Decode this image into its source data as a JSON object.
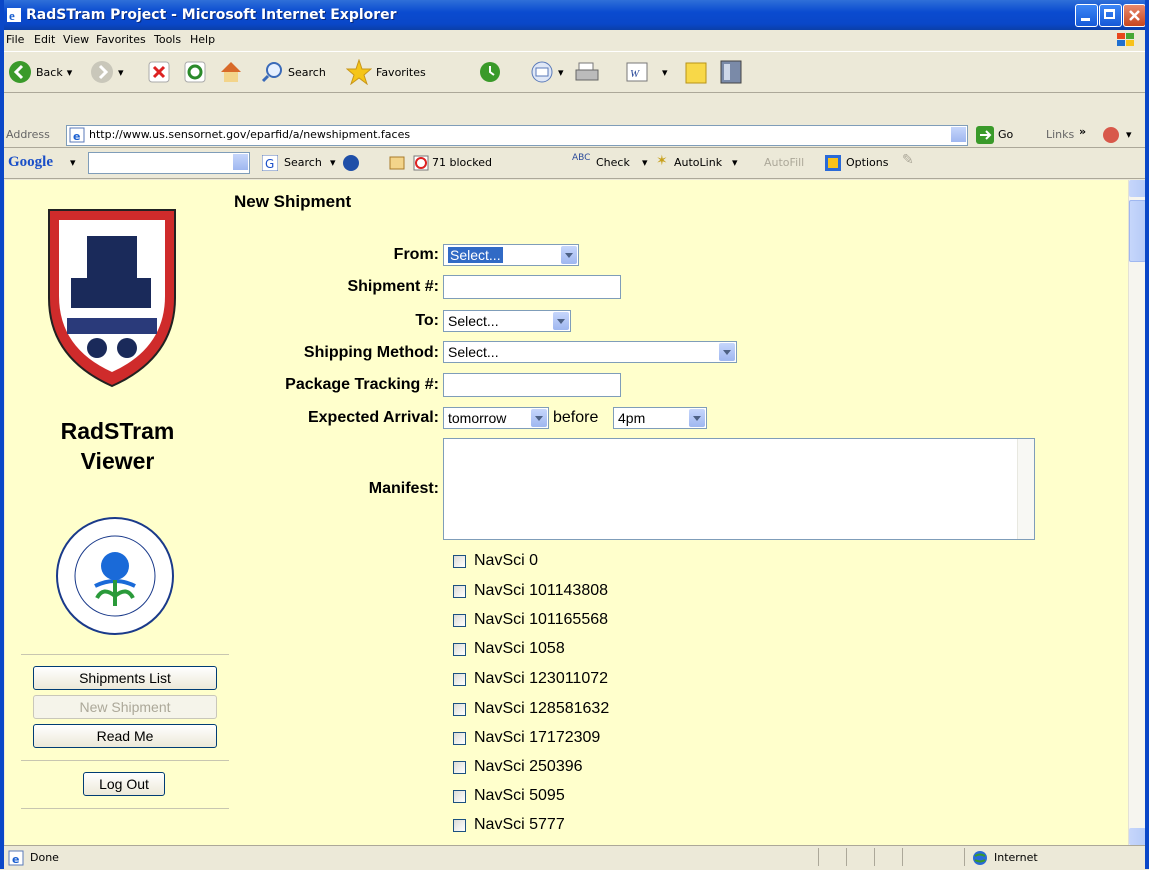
{
  "window": {
    "title": "RadSTram Project - Microsoft Internet Explorer"
  },
  "menu": [
    "File",
    "Edit",
    "View",
    "Favorites",
    "Tools",
    "Help"
  ],
  "toolbar": {
    "back": "Back",
    "search": "Search",
    "favorites": "Favorites"
  },
  "address": {
    "label": "Address",
    "url": "http://www.us.sensornet.gov/eparfid/a/newshipment.faces",
    "go": "Go",
    "links": "Links"
  },
  "google": {
    "logo": "Google",
    "search": "Search",
    "blocked": "71 blocked",
    "check": "Check",
    "autolink": "AutoLink",
    "autofill": "AutoFill",
    "options": "Options"
  },
  "sidebar": {
    "app_title_1": "RadSTram",
    "app_title_2": "Viewer",
    "shipments_list": "Shipments List",
    "new_shipment": "New Shipment",
    "read_me": "Read Me",
    "log_out": "Log Out"
  },
  "form": {
    "heading": "New Shipment",
    "from_label": "From:",
    "from_value": "Select...",
    "shipment_label": "Shipment #:",
    "to_label": "To:",
    "to_value": "Select...",
    "method_label": "Shipping Method:",
    "method_value": "Select...",
    "tracking_label": "Package Tracking #:",
    "arrival_label": "Expected Arrival:",
    "arrival_day": "tomorrow",
    "before": "before",
    "arrival_time": "4pm",
    "manifest_label": "Manifest:"
  },
  "items": [
    "NavSci 0",
    "NavSci 101143808",
    "NavSci 101165568",
    "NavSci 1058",
    "NavSci 123011072",
    "NavSci 128581632",
    "NavSci 17172309",
    "NavSci 250396",
    "NavSci 5095",
    "NavSci 5777"
  ],
  "status": {
    "text": "Done",
    "zone": "Internet"
  }
}
